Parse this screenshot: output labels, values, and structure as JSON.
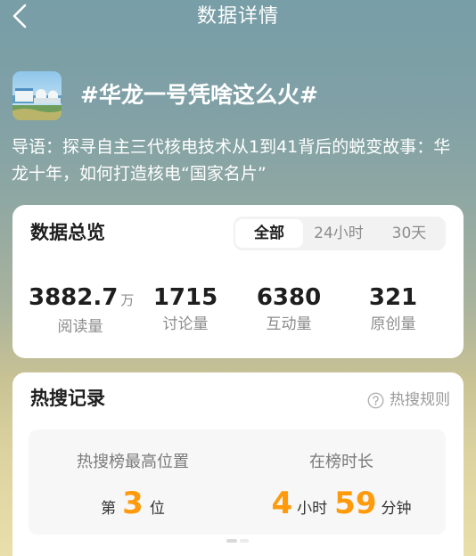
{
  "header": {
    "back_icon": "chevron-left-icon",
    "title": "数据详情"
  },
  "topic": {
    "thumbnail": "nuclear-power-plant-photo",
    "title": "#华龙一号凭啥这么火#",
    "intro_lines": [
      "导语：探寻自主三代核电技术从1到41背后的蜕变故事：华",
      "龙十年，如何打造核电“国家名片”"
    ]
  },
  "overview": {
    "title": "数据总览",
    "tabs": [
      {
        "label": "全部",
        "selected": true
      },
      {
        "label": "24小时",
        "selected": false
      },
      {
        "label": "30天",
        "selected": false
      }
    ],
    "stats": [
      {
        "value": "3882.7",
        "unit": "万",
        "label": "阅读量"
      },
      {
        "value": "1715",
        "label": "讨论量"
      },
      {
        "value": "6380",
        "label": "互动量"
      },
      {
        "value": "321",
        "label": "原创量"
      }
    ]
  },
  "hot_search": {
    "title": "热搜记录",
    "rules_icon": "question-circle-icon",
    "rules_label": "热搜规则",
    "peak": {
      "label": "热搜榜最高位置",
      "prefix": "第",
      "value": "3",
      "suffix": "位"
    },
    "duration": {
      "label": "在榜时长",
      "hours": "4",
      "hours_unit": "小时",
      "minutes": "59",
      "minutes_unit": "分钟"
    }
  },
  "colors": {
    "accent": "#ff9a0d",
    "card_background": "#ffffff",
    "panel_background": "#f7f7f7",
    "muted_text": "#8c8c8c"
  }
}
